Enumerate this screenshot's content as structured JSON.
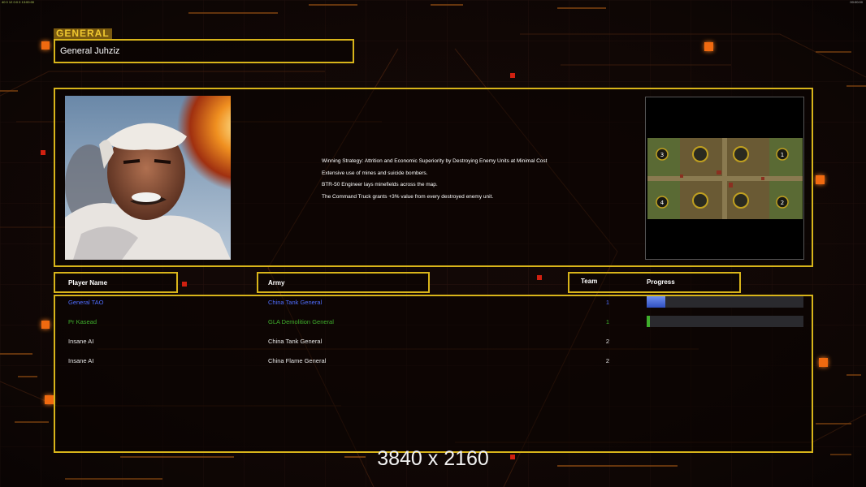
{
  "topbar": {
    "left_text": "40 0 12 0:0 0 13:00:00",
    "right_text": "00:00:00"
  },
  "colors": {
    "frame": "#d8b41a",
    "player_blue": "#4f6dff",
    "player_green": "#3fae2c",
    "ai_white": "#e8e8e8",
    "accent_orange": "#f06a10"
  },
  "general_section": {
    "tab_label": "GENERAL",
    "general_name": "General Juhziz"
  },
  "portrait": {
    "icon": "general-portrait-image"
  },
  "strategy": {
    "lines": [
      "Winning Strategy: Attrition and Economic Superiority by Destroying Enemy Units at Minimal Cost",
      "Extensive use of mines and suicide bombers.",
      "BTR-50 Engineer lays minefields across the map.",
      "The Command Truck grants +3% value from every destroyed enemy unit."
    ]
  },
  "minimap": {
    "icon": "map-preview-image",
    "start_positions": [
      "1",
      "2",
      "3",
      "4"
    ]
  },
  "table": {
    "headers": {
      "player_name": "Player Name",
      "army": "Army",
      "team": "Team",
      "progress": "Progress"
    },
    "rows": [
      {
        "player": "General TAO",
        "army": "China Tank General",
        "team": "1",
        "progress": 0.12,
        "color": "#4f6dff"
      },
      {
        "player": "Pr Kasead",
        "army": "GLA Demolition General",
        "team": "1",
        "progress": 0.02,
        "color": "#3fae2c"
      },
      {
        "player": "Insane AI",
        "army": "China Tank General",
        "team": "2",
        "progress": null,
        "color": "#e8e8e8"
      },
      {
        "player": "Insane AI",
        "army": "China Flame General",
        "team": "2",
        "progress": null,
        "color": "#e8e8e8"
      }
    ]
  },
  "watermark": "3840 x 2160"
}
